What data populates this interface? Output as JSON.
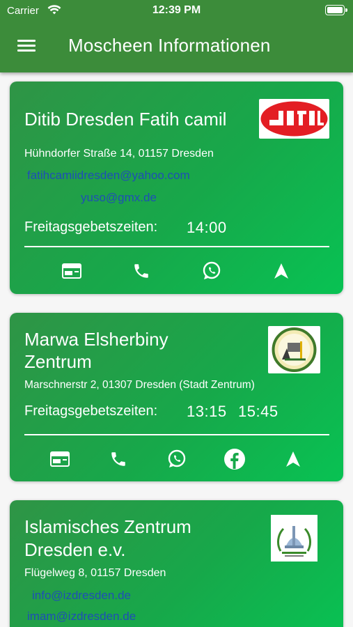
{
  "status_bar": {
    "carrier": "Carrier",
    "time": "12:39 PM"
  },
  "app_bar": {
    "title": "Moscheen Informationen"
  },
  "prayer_label": "Freitagsgebetszeiten:",
  "mosques": [
    {
      "name": "Ditib Dresden Fatih camil",
      "address": "Hühndorfer Straße 14, 01157 Dresden",
      "emails": [
        "fatihcamiidresden@yahoo.com",
        "yuso@gmx.de"
      ],
      "prayer_times": [
        "14:00"
      ],
      "logo_text": "DiTiB"
    },
    {
      "name_line1": "Marwa Elsherbiny",
      "name_line2": "Zentrum",
      "address": "Marschnerstr 2, 01307 Dresden (Stadt Zentrum)",
      "prayer_times": [
        "13:15",
        "15:45"
      ]
    },
    {
      "name_line1": "Islamisches Zentrum",
      "name_line2": "Dresden e.v.",
      "address": "Flügelweg 8, 01157 Dresden",
      "emails": [
        "info@izdresden.de",
        "imam@izdresden.de"
      ]
    }
  ],
  "colors": {
    "app_bar": "#3c8c3a",
    "card_start": "#2f9446",
    "card_end": "#08c253",
    "link": "#1e4fb5"
  }
}
